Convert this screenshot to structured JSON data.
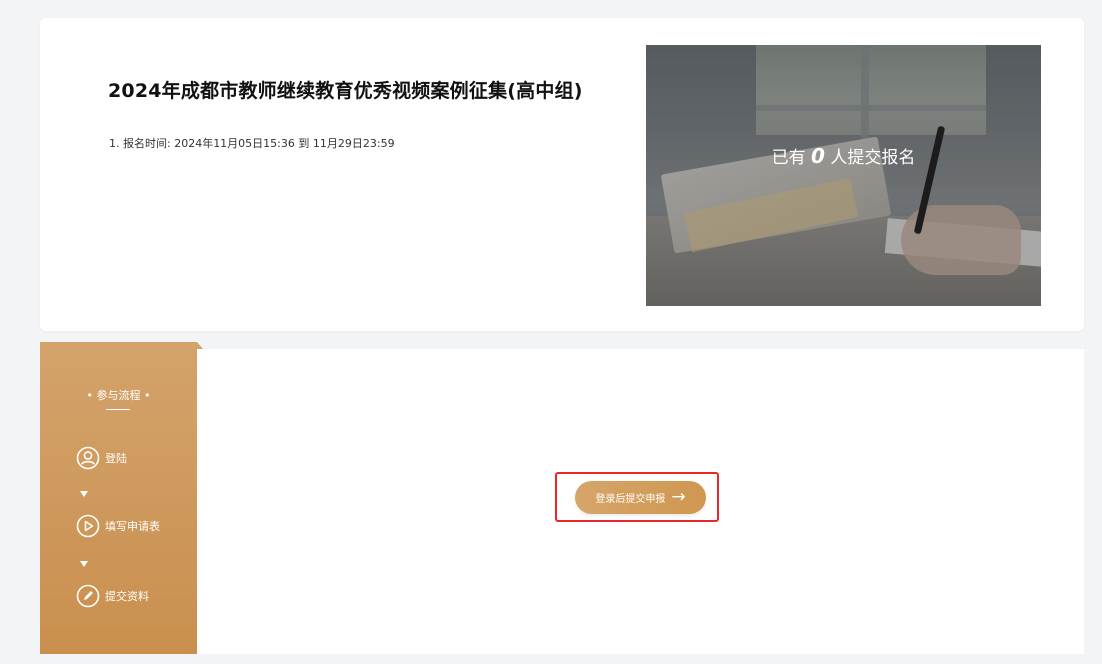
{
  "event": {
    "title": "2024年成都市教师继续教育优秀视频案例征集(高中组)",
    "registration_time": "1. 报名时间: 2024年11月05日15:36 到 11月29日23:59"
  },
  "banner": {
    "prefix": "已有",
    "count": "0",
    "suffix": "人提交报名"
  },
  "sidebar": {
    "title": "• 参与流程 •",
    "steps": [
      {
        "label": "登陆",
        "icon": "user-icon"
      },
      {
        "label": "填写申请表",
        "icon": "play-icon"
      },
      {
        "label": "提交资料",
        "icon": "pencil-icon"
      }
    ]
  },
  "action": {
    "submit_label": "登录后提交申报",
    "submit_arrow": "→"
  },
  "colors": {
    "accent": "#cf9750",
    "highlight": "#e8272b"
  }
}
